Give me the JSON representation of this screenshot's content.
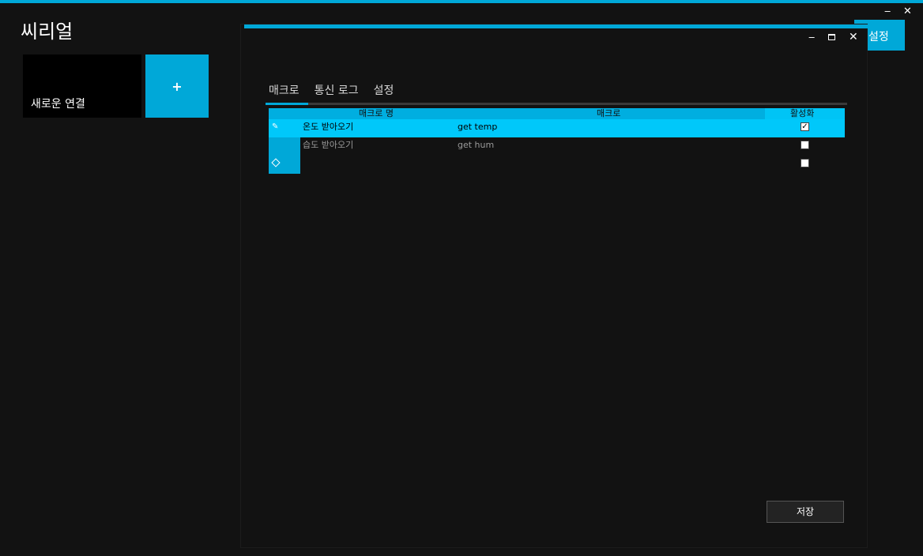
{
  "app": {
    "title": "씨리얼",
    "minimize": "‒",
    "close": "✕"
  },
  "background": {
    "settings_label": "설정"
  },
  "tiles": {
    "new_connection": "새로운 연결",
    "add": "+"
  },
  "dialog": {
    "minimize": "‒",
    "close": "✕",
    "tabs": [
      {
        "label": "매크로",
        "active": true
      },
      {
        "label": "통신 로그",
        "active": false
      },
      {
        "label": "설정",
        "active": false
      }
    ],
    "table": {
      "headers": {
        "name": "매크로 명",
        "macro": "매크로",
        "active": "활성화"
      },
      "rows": [
        {
          "name": "온도 받아오기",
          "macro": "get temp",
          "active": "✓",
          "selected": true
        },
        {
          "name": "습도 받아오기",
          "macro": "get hum",
          "active": "",
          "selected": false
        },
        {
          "name": "",
          "macro": "",
          "active": "",
          "selected": false
        }
      ]
    },
    "save_label": "저장"
  },
  "colors": {
    "accent": "#00a8d8",
    "selection": "#00c8fa",
    "background": "#121212"
  }
}
